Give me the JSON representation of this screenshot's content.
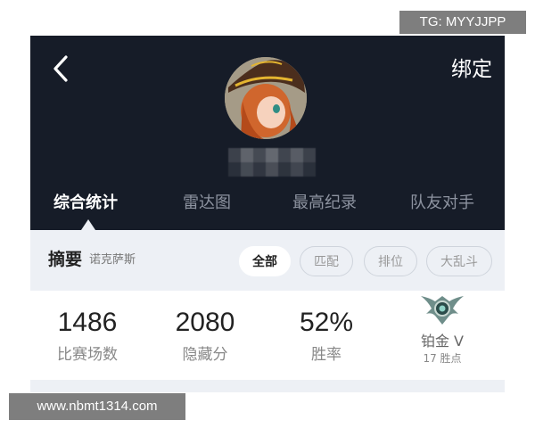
{
  "watermarks": {
    "top_right": "TG: MYYJJPP",
    "bottom_left": "www.nbmt1314.com"
  },
  "header": {
    "back_icon": "chevron-left-icon",
    "bind_label": "绑定"
  },
  "tabs": [
    {
      "label": "综合统计",
      "active": true
    },
    {
      "label": "雷达图",
      "active": false
    },
    {
      "label": "最高纪录",
      "active": false
    },
    {
      "label": "队友对手",
      "active": false
    }
  ],
  "summary": {
    "title": "摘要",
    "champion": "诺克萨斯",
    "filters": [
      {
        "label": "全部",
        "selected": true
      },
      {
        "label": "匹配",
        "selected": false
      },
      {
        "label": "排位",
        "selected": false
      },
      {
        "label": "大乱斗",
        "selected": false
      }
    ]
  },
  "stats": [
    {
      "value": "1486",
      "label": "比赛场数"
    },
    {
      "value": "2080",
      "label": "隐藏分"
    },
    {
      "value": "52%",
      "label": "胜率"
    }
  ],
  "rank": {
    "label": "铂金 V",
    "wins": "17 胜点",
    "emblem_icon": "platinum-rank-emblem-icon"
  },
  "colors": {
    "header_bg": "#161c28",
    "summary_bg": "#edf0f5",
    "active_tab": "#ffffff",
    "inactive_tab": "#8d93a0"
  }
}
